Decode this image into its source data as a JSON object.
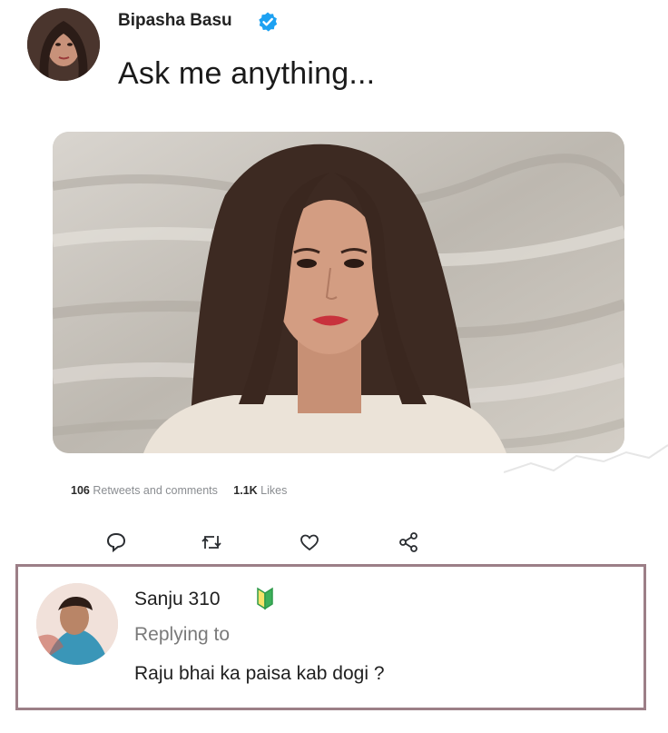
{
  "tweet": {
    "author": "Bipasha Basu",
    "text": "Ask me anything...",
    "retweets_count": "106",
    "retweets_label": "Retweets and comments",
    "likes_count": "1.1K",
    "likes_label": "Likes"
  },
  "actions": [
    {
      "icon": "reply-icon"
    },
    {
      "icon": "retweet-icon"
    },
    {
      "icon": "like-icon"
    },
    {
      "icon": "share-icon"
    }
  ],
  "reply": {
    "author": "Sanju 310",
    "replying": "Replying to",
    "text": "Raju bhai ka paisa kab dogi ?"
  },
  "colors": {
    "verified": "#1da1f2",
    "reply_border": "#9c7f87",
    "muted": "#8a8d91"
  }
}
